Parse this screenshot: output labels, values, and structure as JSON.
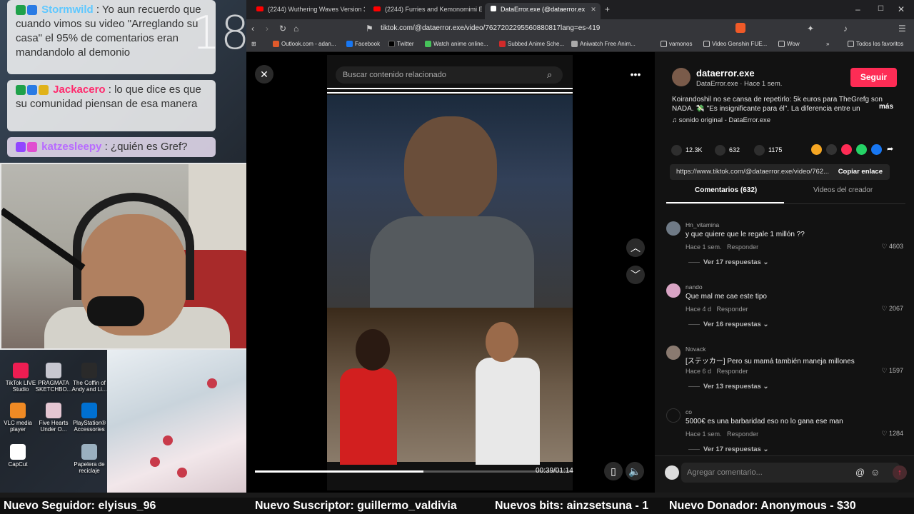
{
  "stream": {
    "counter": "18",
    "chat": [
      {
        "user": "Stormwild",
        "user_color": "#5ec8ff",
        "text": ": Yo aun recuerdo que cuando vimos su video \"Arreglando su casa\" el 95% de comentarios eran mandandolo al demonio"
      },
      {
        "user": "Jackacero",
        "user_color": "#ff2a6d",
        "text": ": lo que dice es que su comunidad piensan de esa manera"
      },
      {
        "user": "katzesleepy",
        "user_color": "#b86bff",
        "text": ": ¿quién es Gref?"
      }
    ],
    "desktop_icons": [
      {
        "label": "TikTok LIVE Studio"
      },
      {
        "label": "PRAGMATA SKETCHBO..."
      },
      {
        "label": "The Coffin of Andy and Li..."
      },
      {
        "label": "VLC media player"
      },
      {
        "label": "Five Hearts Under O..."
      },
      {
        "label": "PlayStation® Accessories"
      },
      {
        "label": "CapCut"
      },
      {
        "label": "Papelera de reciclaje"
      }
    ],
    "ticker": {
      "follower": "Nuevo Seguidor: elyisus_96",
      "subscriber": "Nuevo Suscriptor: guillermo_valdivia",
      "bits": "Nuevos bits: ainzsetsuna - 1",
      "donor": "Nuevo Donador: Anonymous - $30"
    }
  },
  "browser": {
    "tabs": [
      {
        "title": "(2244) Wuthering Waves Version 3.3",
        "active": false
      },
      {
        "title": "(2244) Furries and Kemonomimi Expl",
        "active": false
      },
      {
        "title": "DataError.exe (@dataerror.ex",
        "active": true
      }
    ],
    "url": "tiktok.com/@dataerror.exe/video/7627202295560880817lang=es-419",
    "bookmarks": [
      {
        "label": "Outlook.com - adan...",
        "color": "#e05a2b"
      },
      {
        "label": "Facebook",
        "color": "#1877f2"
      },
      {
        "label": "Twitter",
        "color": "#000000"
      },
      {
        "label": "Watch anime online...",
        "color": "#46c35a"
      },
      {
        "label": "Subbed Anime Sche...",
        "color": "#d12a2a"
      },
      {
        "label": "Aniwatch Free Anim...",
        "color": "#aaaaaa"
      },
      {
        "label": "vamonos",
        "color": "#cccccc"
      },
      {
        "label": "Video Genshin FUE...",
        "color": "#cccccc"
      },
      {
        "label": "Wow",
        "color": "#cccccc"
      }
    ],
    "bookmarks_all": "Todos los favoritos"
  },
  "video": {
    "search_placeholder": "Buscar contenido relacionado",
    "time": "00:39/01:14",
    "progress": 0.53
  },
  "creator": {
    "name": "dataerror.exe",
    "handle_time": "DataError.exe · Hace 1 sem.",
    "follow": "Seguir",
    "description": "Koirandoshil no se cansa de repetirlo: 5k euros para TheGrefg son NADA. 💸 \"Es insignificante para él\". La diferencia entre un",
    "more": "más",
    "sound": "sonido original - DataError.exe"
  },
  "stats": {
    "likes": "12.3K",
    "comments": "632",
    "saves": "1175"
  },
  "share_colors": [
    "#f5a623",
    "#333333",
    "#fe2c55",
    "#25d366",
    "#1877f2",
    "#ffffff"
  ],
  "link": {
    "url": "https://www.tiktok.com/@dataerror.exe/video/762...",
    "copy": "Copiar enlace"
  },
  "tabs": {
    "comments": "Comentarios (632)",
    "creator_videos": "Videos del creador"
  },
  "comments": [
    {
      "user": "Hn_vitamina",
      "text": "y que quiere que le regale 1 millón ??",
      "time": "Hace 1 sem.",
      "reply": "Responder",
      "likes": "4603",
      "replies": "Ver 17 respuestas"
    },
    {
      "user": "nando",
      "text": "Que mal me cae este tipo",
      "time": "Hace 4 d",
      "reply": "Responder",
      "likes": "2067",
      "replies": "Ver 16 respuestas"
    },
    {
      "user": "Novack",
      "text": "[ステッカー] Pero su mamá también maneja millones",
      "time": "Hace 6 d",
      "reply": "Responder",
      "likes": "1597",
      "replies": "Ver 13 respuestas"
    },
    {
      "user": "co",
      "text": "5000€ es una barbaridad eso no lo gana ese man",
      "time": "Hace 1 sem.",
      "reply": "Responder",
      "likes": "1284",
      "replies": "Ver 17 respuestas"
    }
  ],
  "add_comment_placeholder": "Agregar comentario..."
}
